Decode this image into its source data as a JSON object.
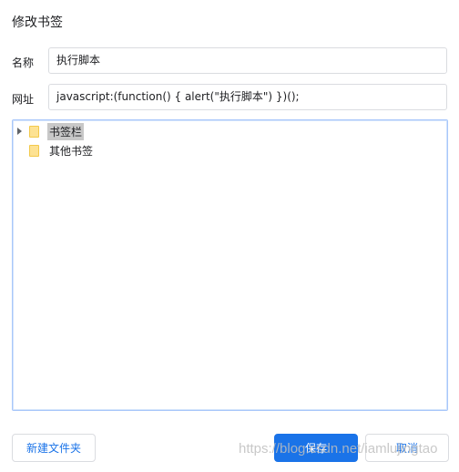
{
  "dialog": {
    "title": "修改书签"
  },
  "form": {
    "name_label": "名称",
    "name_value": "执行脚本",
    "url_label": "网址",
    "url_value": "javascript:(function() {  alert(\"执行脚本\")  })();"
  },
  "tree": {
    "items": [
      {
        "label": "书签栏",
        "expandable": true,
        "selected": true,
        "icon": "folder-icon"
      },
      {
        "label": "其他书签",
        "expandable": false,
        "selected": false,
        "icon": "folder-icon"
      }
    ]
  },
  "buttons": {
    "new_folder": "新建文件夹",
    "save": "保存",
    "cancel": "取消"
  },
  "watermark": "https://blog.csdn.net/iamlujingtao",
  "colors": {
    "accent": "#1a73e8",
    "tree_border": "#a8c7fa",
    "folder": "#fde293"
  }
}
